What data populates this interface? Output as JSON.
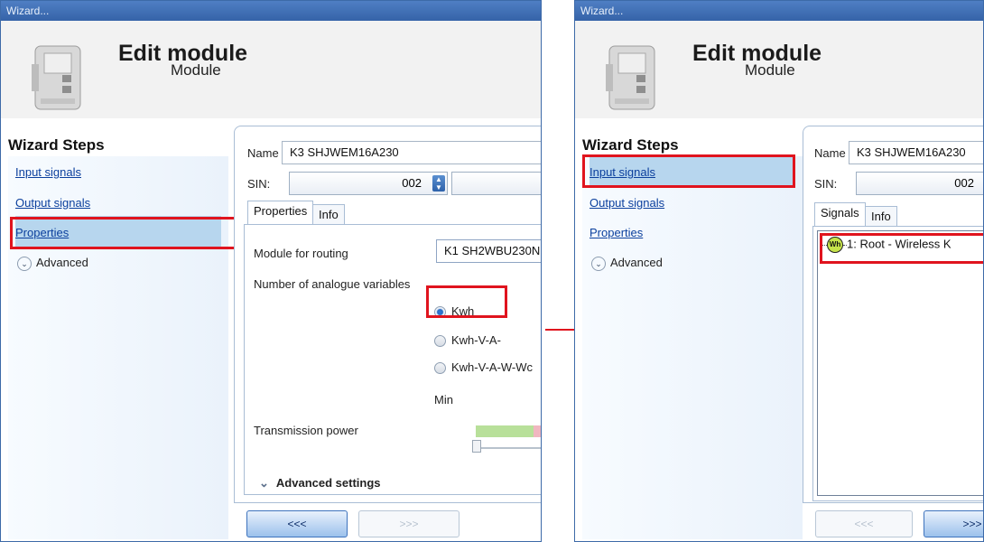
{
  "colors": {
    "accent": "#3563a8",
    "highlight_red": "#e0141e",
    "selected_step": "#b7d6ee",
    "link": "#0b3f9d"
  },
  "left": {
    "window_title": "Wizard...",
    "header_title": "Edit module",
    "header_subtitle": "Module",
    "wizard_steps_label": "Wizard Steps",
    "steps": [
      {
        "label": "Input signals"
      },
      {
        "label": "Output signals"
      },
      {
        "label": "Properties"
      }
    ],
    "advanced_label": "Advanced",
    "name_label": "Name",
    "name_value": "K3 SHJWEM16A230",
    "sin_label": "SIN:",
    "sin_value": "002",
    "tabs": [
      "Properties",
      "Info"
    ],
    "module_routing_label": "Module for routing",
    "module_routing_value": "K1 SH2WBU230N",
    "analogue_label": "Number of analogue variables",
    "radio_options": [
      "Kwh",
      "Kwh-V-A-",
      "Kwh-V-A-W-Wc"
    ],
    "min_label": "Min",
    "transmission_label": "Transmission power",
    "advanced_settings_label": "Advanced settings",
    "back_button": "<<<",
    "next_button": ">>>"
  },
  "right": {
    "window_title": "Wizard...",
    "header_title": "Edit module",
    "header_subtitle": "Module",
    "wizard_steps_label": "Wizard Steps",
    "steps": [
      {
        "label": "Input signals"
      },
      {
        "label": "Output signals"
      },
      {
        "label": "Properties"
      }
    ],
    "advanced_label": "Advanced",
    "name_label": "Name",
    "name_value": "K3 SHJWEM16A230",
    "sin_label": "SIN:",
    "sin_value": "002",
    "tabs": [
      "Signals",
      "Info"
    ],
    "signal_icon_text": "Wh",
    "signal_item": "1: Root - Wireless K",
    "back_button": "<<<",
    "next_button": ">>>"
  }
}
